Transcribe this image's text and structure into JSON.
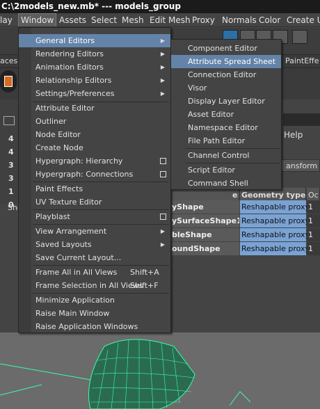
{
  "title": "C:\\2models_new.mb*  ---  models_group",
  "menubar": [
    "lay",
    "Window",
    "Assets",
    "Select",
    "Mesh",
    "Edit Mesh",
    "Proxy",
    "Normals",
    "Color",
    "Create UV"
  ],
  "tabs": [
    "aces",
    "PaintEffe"
  ],
  "shelf_label": "Sho",
  "channel_numbers": [
    "4",
    "4",
    "3",
    "3",
    "1",
    "0"
  ],
  "window_menu": {
    "items": [
      {
        "label": "General Editors",
        "arrow": true,
        "highlight": true
      },
      {
        "label": "Rendering Editors",
        "arrow": true
      },
      {
        "label": "Animation Editors",
        "arrow": true
      },
      {
        "label": "Relationship Editors",
        "arrow": true
      },
      {
        "label": "Settings/Preferences",
        "arrow": true
      },
      {
        "label": "Attribute Editor"
      },
      {
        "label": "Outliner"
      },
      {
        "label": "Node Editor"
      },
      {
        "label": "Create Node"
      },
      {
        "label": "Hypergraph: Hierarchy",
        "box": true
      },
      {
        "label": "Hypergraph: Connections",
        "box": true
      },
      {
        "label": "Paint Effects"
      },
      {
        "label": "UV Texture Editor"
      },
      {
        "label": "Playblast",
        "box": true
      },
      {
        "label": "View Arrangement",
        "arrow": true
      },
      {
        "label": "Saved Layouts",
        "arrow": true
      },
      {
        "label": "Save Current Layout..."
      },
      {
        "label": "Frame All in All Views",
        "shortcut": "Shift+A"
      },
      {
        "label": "Frame Selection in All Views",
        "shortcut": "Shift+F"
      },
      {
        "label": "Minimize Application"
      },
      {
        "label": "Raise Main Window"
      },
      {
        "label": "Raise Application Windows"
      }
    ]
  },
  "general_editors_menu": {
    "items": [
      {
        "label": "Component Editor"
      },
      {
        "label": "Attribute Spread Sheet",
        "highlight": true
      },
      {
        "label": "Connection Editor"
      },
      {
        "label": "Visor"
      },
      {
        "label": "Display Layer Editor"
      },
      {
        "label": "Asset Editor"
      },
      {
        "label": "Namespace Editor"
      },
      {
        "label": "File Path Editor"
      },
      {
        "label": "Channel Control"
      },
      {
        "label": "Script Editor"
      },
      {
        "label": "Command Shell"
      }
    ]
  },
  "sheet": {
    "help": "Help",
    "transform_tab": "ansform",
    "col_partial": "e:",
    "col_geometry": "Geometry type",
    "col_oc": "Oc",
    "rows": [
      {
        "name": "yShape",
        "type": "Reshapable proxy",
        "val": "1"
      },
      {
        "name": "ySurfaceShape1",
        "type": "Reshapable proxy",
        "val": "1"
      },
      {
        "name": "bleShape",
        "type": "Reshapable proxy",
        "val": "1"
      },
      {
        "name": "oundShape",
        "type": "Reshapable proxy",
        "val": "1"
      }
    ]
  },
  "colors": {
    "highlight": "#6483a8",
    "cell_blue": "#7aa3d4",
    "wireframe": "#3dfca8"
  }
}
